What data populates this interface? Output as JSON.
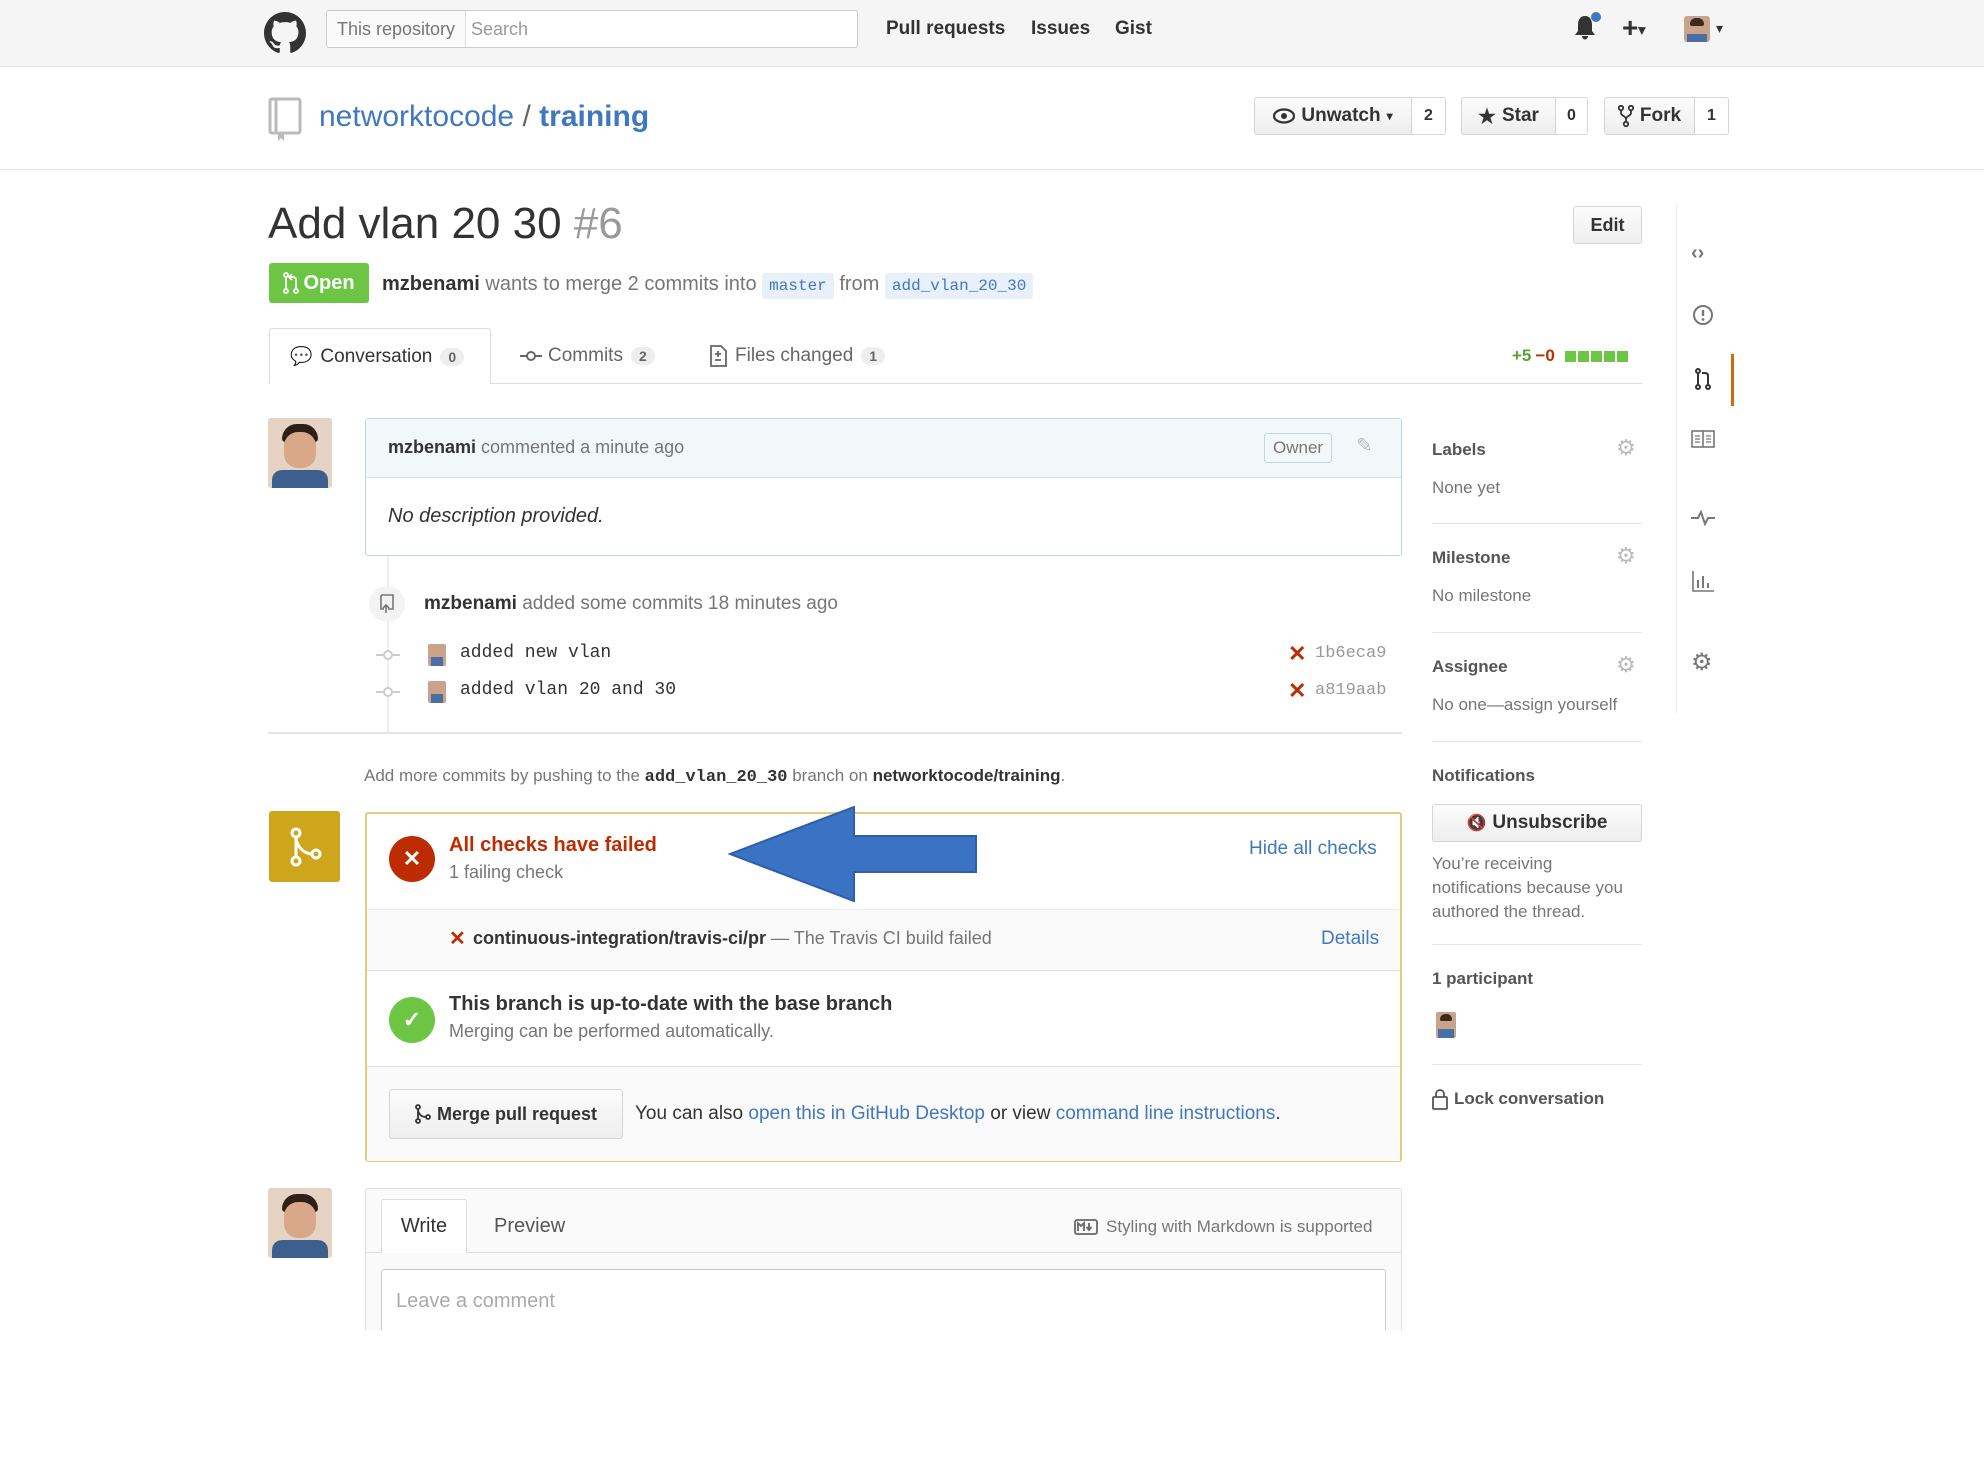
{
  "header": {
    "scope_label": "This repository",
    "search_placeholder": "Search",
    "nav": [
      "Pull requests",
      "Issues",
      "Gist"
    ]
  },
  "repo": {
    "owner": "networktocode",
    "separator": "/",
    "name": "training",
    "unwatch_label": "Unwatch",
    "watch_count": "2",
    "star_label": "Star",
    "star_count": "0",
    "fork_label": "Fork",
    "fork_count": "1"
  },
  "pr": {
    "title": "Add vlan 20 30",
    "number": "#6",
    "edit_label": "Edit",
    "state": "Open",
    "author": "mzbenami",
    "merge_text": "wants to merge 2 commits into",
    "base_branch": "master",
    "from_text": "from",
    "head_branch": "add_vlan_20_30"
  },
  "tabs": [
    {
      "label": "Conversation",
      "count": "0"
    },
    {
      "label": "Commits",
      "count": "2"
    },
    {
      "label": "Files changed",
      "count": "1"
    }
  ],
  "diffstat": {
    "additions": "+5",
    "deletions": "−0"
  },
  "comment": {
    "author": "mzbenami",
    "action": "commented a minute ago",
    "owner_badge": "Owner",
    "body": "No description provided."
  },
  "commits_event": {
    "author": "mzbenami",
    "action": "added some commits 18 minutes ago",
    "commits": [
      {
        "message": "added new vlan",
        "sha": "1b6eca9"
      },
      {
        "message": "added vlan 20 and 30",
        "sha": "a819aab"
      }
    ]
  },
  "push_hint": {
    "prefix": "Add more commits by pushing to the",
    "branch": "add_vlan_20_30",
    "middle": "branch on",
    "repo": "networktocode/training",
    "suffix": "."
  },
  "checks": {
    "title": "All checks have failed",
    "subtitle": "1 failing check",
    "hide_label": "Hide all checks",
    "check_name": "continuous-integration/travis-ci/pr",
    "check_desc": "— The Travis CI build failed",
    "details_label": "Details",
    "branch_status_title": "This branch is up-to-date with the base branch",
    "branch_status_sub": "Merging can be performed automatically.",
    "merge_button": "Merge pull request",
    "merge_hint_prefix": "You can also",
    "desktop_link": "open this in GitHub Desktop",
    "merge_hint_mid": "or view",
    "cli_link": "command line instructions",
    "merge_hint_suffix": "."
  },
  "composer": {
    "write_tab": "Write",
    "preview_tab": "Preview",
    "markdown_hint": "Styling with Markdown is supported",
    "placeholder": "Leave a comment"
  },
  "sidebar": {
    "labels_title": "Labels",
    "labels_value": "None yet",
    "milestone_title": "Milestone",
    "milestone_value": "No milestone",
    "assignee_title": "Assignee",
    "assignee_value": "No one—assign yourself",
    "notifications_title": "Notifications",
    "unsubscribe_label": "Unsubscribe",
    "notifications_reason": "You’re receiving notifications because you authored the thread.",
    "participants_title": "1 participant",
    "lock_label": "Lock conversation"
  },
  "colors": {
    "open_green": "#6cc644",
    "fail_red": "#bd2c00",
    "check_yellow": "#cea61b",
    "link_blue": "#4078c0",
    "arrow_blue": "#3a72c4"
  },
  "icons": [
    "github-logo-icon",
    "bell-icon",
    "plus-icon",
    "eye-icon",
    "star-icon",
    "fork-icon",
    "repo-icon",
    "pull-request-icon",
    "comment-icon",
    "commit-icon",
    "file-diff-icon",
    "pencil-icon",
    "gear-icon",
    "x-icon",
    "check-icon",
    "merge-icon",
    "markdown-icon",
    "mute-icon",
    "lock-icon",
    "code-icon",
    "issue-icon",
    "book-icon",
    "pulse-icon",
    "graph-icon",
    "settings-icon",
    "arrow-left-icon"
  ]
}
